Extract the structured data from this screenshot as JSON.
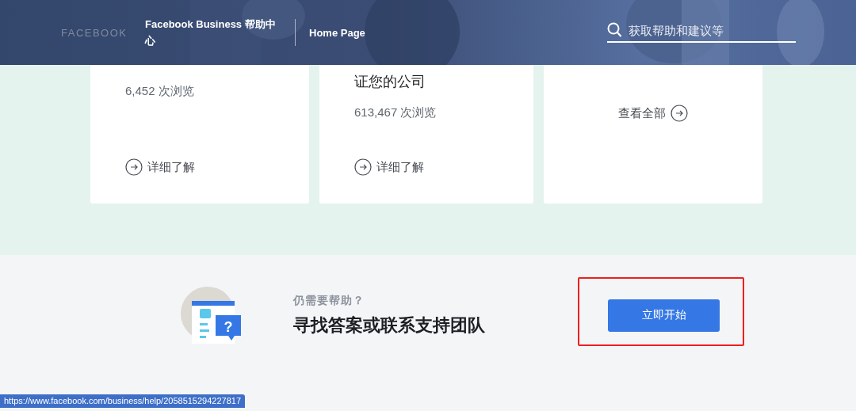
{
  "header": {
    "brand": "FACEBOOK",
    "title": "Facebook Business 帮助中心",
    "nav_link": "Home Page",
    "search": {
      "placeholder": "获取帮助和建议等"
    }
  },
  "cards": [
    {
      "kind": "article",
      "views": "6,452 次浏览",
      "link": "详细了解"
    },
    {
      "kind": "article",
      "title": "证您的公司",
      "views": "613,467 次浏览",
      "link": "详细了解"
    },
    {
      "kind": "more",
      "link": "查看全部"
    }
  ],
  "help": {
    "icon_mark": "?",
    "eyebrow": "仍需要帮助？",
    "heading": "寻找答案或联系支持团队",
    "button": "立即开始",
    "highlighted": true
  },
  "status_url": "https://www.facebook.com/business/help/2058515294227817"
}
